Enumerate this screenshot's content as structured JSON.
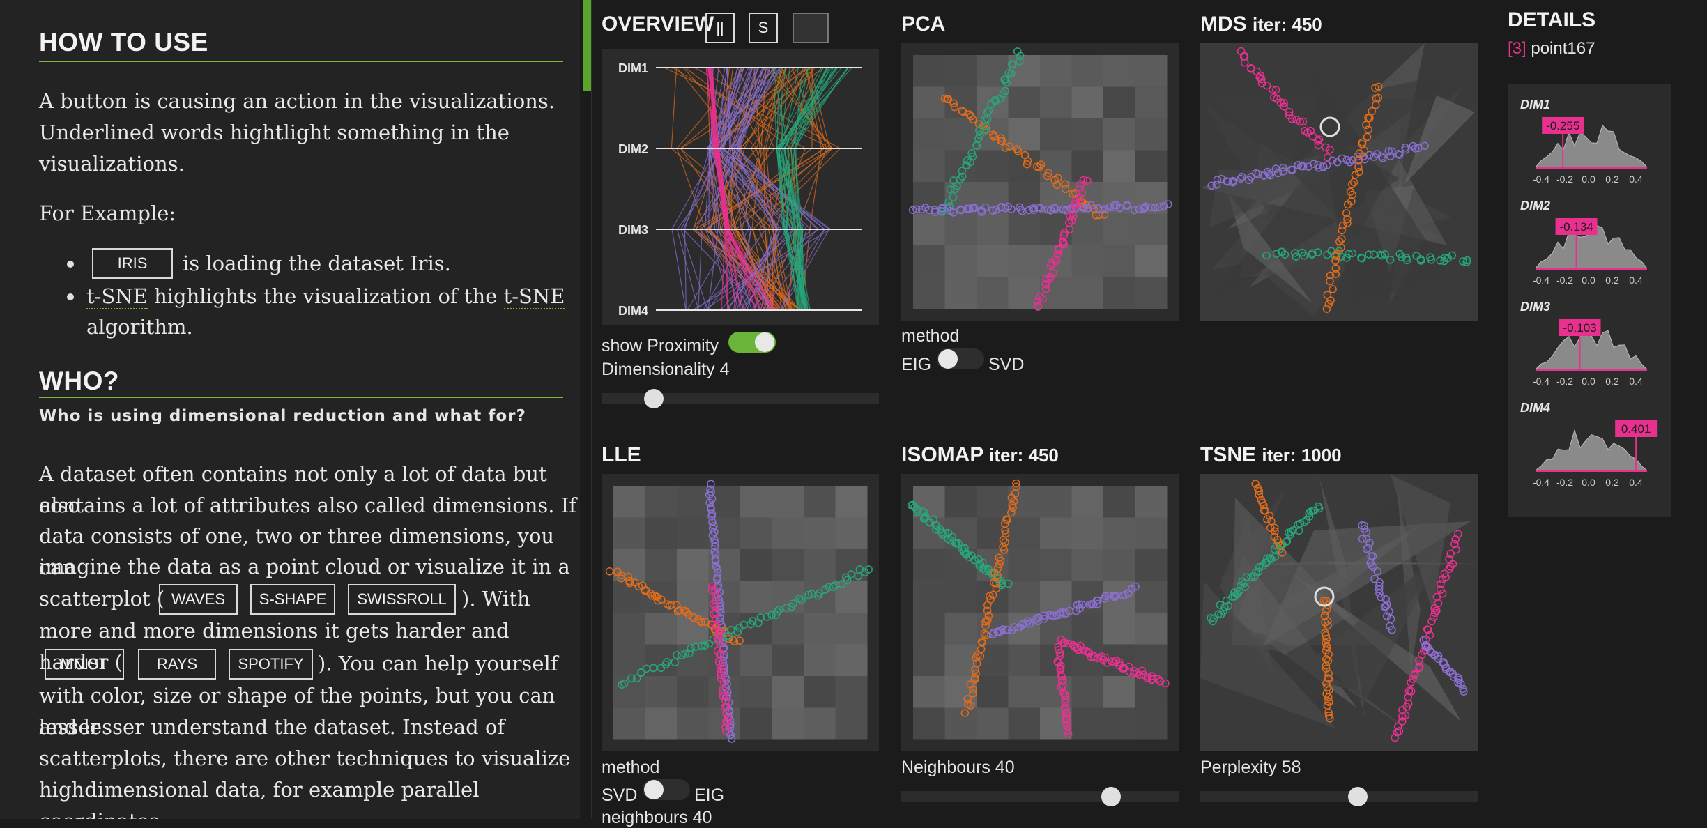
{
  "left": {
    "how_title": "HOW TO USE",
    "how_p1": "A button is causing an action in the visualizations.",
    "how_p2": "Underlined words hightlight something in the",
    "how_p3": "visualizations.",
    "for_example": "For Example:",
    "bullet1_btn": "IRIS",
    "bullet1_text": "is loading the dataset Iris.",
    "bullet2_word1": "t-SNE",
    "bullet2_mid": "highlights the visualization of the",
    "bullet2_word2": "t-SNE",
    "bullet2_end": "algorithm.",
    "who_title": "WHO?",
    "who_sub": "Who is using dimensional reduction and what for?",
    "para_lines": [
      "A dataset often contains not only a lot of data but also",
      "contains a lot of attributes also called dimensions. If",
      "data consists of one, two or three dimensions, you can",
      "imagine the data as a point cloud or visualize it in a"
    ],
    "scatter_pre": "scatterplot (",
    "scatter_post": "). With",
    "more_line": "more and more dimensions it gets harder and harder (",
    "help_post": "). You can help yourself",
    "tail_lines": [
      "with color, size or shape of the points, but you can lesser",
      "and lesser understand the dataset. Instead of",
      "scatterplots, there are other techniques to visualize",
      "highdimensional data, for example parallel coordinates"
    ],
    "buttons_row1": [
      "WAVES",
      "S-SHAPE",
      "SWISSROLL"
    ],
    "buttons_row2": [
      "MNIST",
      "RAYS",
      "SPOTIFY"
    ]
  },
  "overview": {
    "title": "OVERVIEW",
    "btn_parallel": "||",
    "btn_s": "S",
    "btn_third": "",
    "dims": [
      "DIM1",
      "DIM2",
      "DIM3",
      "DIM4"
    ],
    "show_proximity": "show Proximity",
    "show_proximity_on": true,
    "dimensionality_label": "Dimensionality 4",
    "dimensionality_value": 4
  },
  "pca": {
    "title": "PCA",
    "method_label": "method",
    "opt_left": "EIG",
    "opt_right": "SVD"
  },
  "mds": {
    "title": "MDS",
    "iter": "iter: 450"
  },
  "lle": {
    "title": "LLE",
    "method_label": "method",
    "opt_left": "SVD",
    "opt_right": "EIG",
    "neighbours_label": "neighbours 40"
  },
  "isomap": {
    "title": "ISOMAP",
    "iter": "iter: 450",
    "neighbours_label": "Neighbours 40",
    "neighbours_value": 40
  },
  "tsne": {
    "title": "TSNE",
    "iter": "iter: 1000",
    "perplexity_label": "Perplexity 58",
    "perplexity_value": 58
  },
  "details": {
    "title": "DETAILS",
    "selected_index": "[3]",
    "selected_name": "point167",
    "dims": [
      {
        "name": "DIM1",
        "value": "-0.255"
      },
      {
        "name": "DIM2",
        "value": "-0.134"
      },
      {
        "name": "DIM3",
        "value": "-0.103"
      },
      {
        "name": "DIM4",
        "value": "0.401"
      }
    ],
    "ticks": [
      "-0.4",
      "-0.2",
      "0.0",
      "0.2",
      "0.4"
    ]
  },
  "colors": {
    "accent": "#7db83a",
    "pink": "#e8318f",
    "orange": "#e06c1c",
    "purple": "#8a6fd1",
    "green": "#27a67a"
  }
}
